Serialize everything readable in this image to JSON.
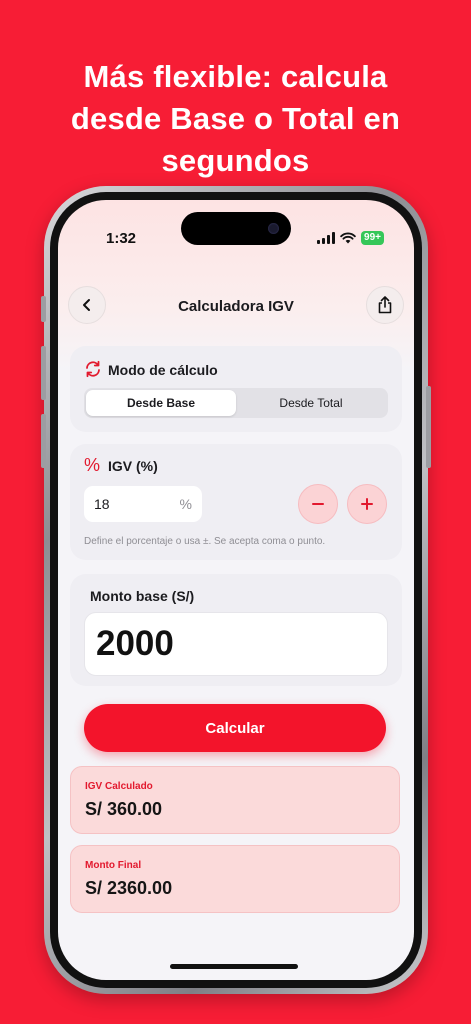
{
  "headline": {
    "line1": "Más flexible: calcula",
    "line2": "desde Base o Total en",
    "line3": "segundos"
  },
  "status_bar": {
    "time": "1:32",
    "battery": "99+"
  },
  "nav": {
    "title": "Calculadora IGV",
    "back_icon": "chevron-left-icon",
    "share_icon": "share-icon"
  },
  "mode": {
    "title": "Modo de cálculo",
    "icon": "refresh-icon",
    "options": [
      "Desde Base",
      "Desde Total"
    ],
    "selected": "Desde Base"
  },
  "igv": {
    "title": "IGV (%)",
    "icon": "percent-icon",
    "value": "18",
    "unit": "%",
    "hint": "Define el porcentaje o usa ±. Se acepta coma o punto."
  },
  "base": {
    "title": "Monto base (S/)",
    "value": "2000"
  },
  "calculate_label": "Calcular",
  "results": [
    {
      "label": "IGV Calculado",
      "value": "S/ 360.00"
    },
    {
      "label": "Monto Final",
      "value": "S/ 2360.00"
    }
  ],
  "colors": {
    "background": "#f71d35",
    "accent": "#f3142b",
    "result_bg": "#fbdada"
  }
}
